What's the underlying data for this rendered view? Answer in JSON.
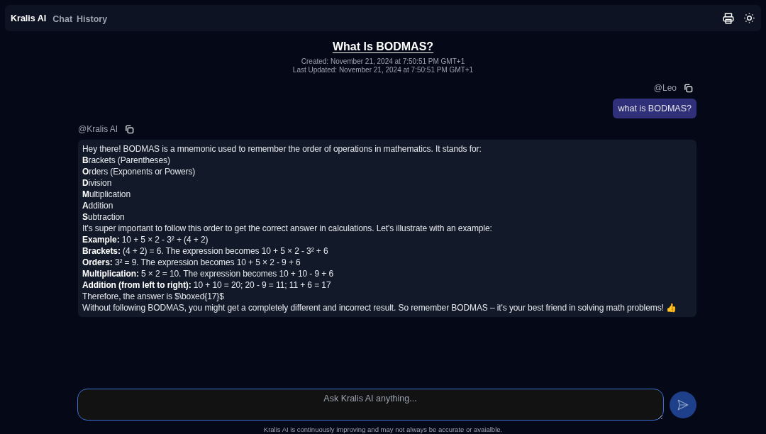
{
  "nav": {
    "brand": "Kralis AI",
    "links": [
      "Chat",
      "History"
    ]
  },
  "conversation": {
    "title": "What Is BODMAS?",
    "created": "Created: November 21, 2024 at 7:50:51 PM GMT+1",
    "updated": "Last Updated: November 21, 2024 at 7:50:51 PM GMT+1"
  },
  "messages": [
    {
      "kind": "user",
      "author": "@Leo",
      "lines": [
        "what is BODMAS?"
      ]
    },
    {
      "kind": "assistant",
      "author": "@Kralis AI",
      "lines": [
        "Hey there! BODMAS is a mnemonic used to remember the order of operations in mathematics. It stands for:",
        "**B**rackets (Parentheses)",
        "**O**rders (Exponents or Powers)",
        "**D**ivision",
        "**M**ultiplication",
        "**A**ddition",
        "**S**ubtraction",
        "It's super important to follow this order to get the correct answer in calculations. Let's illustrate with an example:",
        "**Example:** 10 + 5 × 2 - 3² + (4 + 2)",
        "**Brackets:** (4 + 2) = 6. The expression becomes 10 + 5 × 2 - 3² + 6",
        "**Orders:** 3² = 9. The expression becomes 10 + 5 × 2 - 9 + 6",
        "**Multiplication:** 5 × 2 = 10. The expression becomes 10 + 10 - 9 + 6",
        "**Addition (from left to right):** 10 + 10 = 20; 20 - 9 = 11; 11 + 6 = 17",
        "Therefore, the answer is $\\boxed{17}$",
        "Without following BODMAS, you might get a completely different and incorrect result. So remember BODMAS – it's your best friend in solving math problems! 👍"
      ]
    }
  ],
  "composer": {
    "placeholder": "Ask Kralis AI anything..."
  },
  "disclaimer": "Kralis AI is continuously improving and may not always be accurate or avaialble."
}
